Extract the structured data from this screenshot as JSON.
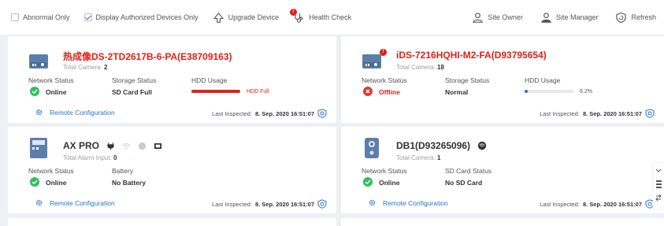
{
  "toolbar": {
    "abnormal_only": "Abnormal Only",
    "display_authorized": "Display Authorized Devices Only",
    "upgrade_device": "Upgrade Device",
    "upgrade_badge": "!",
    "health_check": "Health Check",
    "site_owner": "Site Owner",
    "site_manager": "Site Manager",
    "refresh": "Refresh"
  },
  "cards": [
    {
      "name": "热成像DS-2TD2617B-6-PA(E38709163)",
      "sub_label": "Total Camera:",
      "sub_value": "2",
      "col1_label": "Network Status",
      "col1_value": "Online",
      "col2_label": "Storage Status",
      "col2_value": "SD Card Full",
      "col3_label": "HDD Usage",
      "hdd_text": "HDD Full",
      "hdd_fraction": 1.0,
      "remote": "Remote Configuration",
      "last_label": "Last Inspected:",
      "last_value": "8. Sep. 2020 16:51:07"
    },
    {
      "name": "iDS-7216HQHI-M2-FA(D93795654)",
      "sub_label": "Total Camera:",
      "sub_value": "18",
      "col1_label": "Network Status",
      "col1_value": "Offline",
      "col2_label": "Storage Status",
      "col2_value": "Normal",
      "col3_label": "HDD Usage",
      "hdd_text": "6.2%",
      "hdd_fraction": 0.062,
      "badge": "!",
      "remote": "",
      "last_label": "Last Inspected:",
      "last_value": "8. Sep. 2020 16:51:07"
    },
    {
      "name": "AX PRO",
      "sub_label": "Total Alarm Input:",
      "sub_value": "0",
      "col1_label": "Network Status",
      "col1_value": "Online",
      "col2_label": "Battery",
      "col2_value": "No Battery",
      "remote": "Remote Configuration",
      "last_label": "Last Inspected:",
      "last_value": "8. Sep. 2020 16:51:07"
    },
    {
      "name": "DB1(D93265096)",
      "sub_label": "Total Camera:",
      "sub_value": "1",
      "col1_label": "Network Status",
      "col1_value": "Online",
      "col2_label": "SD Card Status",
      "col2_value": "No SD Card",
      "remote": "Remote Configuration",
      "last_label": "Last Inspected:",
      "last_value": "8. Sep. 2020 16:51:07"
    }
  ],
  "colors": {
    "accent": "#2a72c9",
    "online": "#2fbf5b",
    "offline": "#e23a2c",
    "error_text": "#e0211b"
  }
}
